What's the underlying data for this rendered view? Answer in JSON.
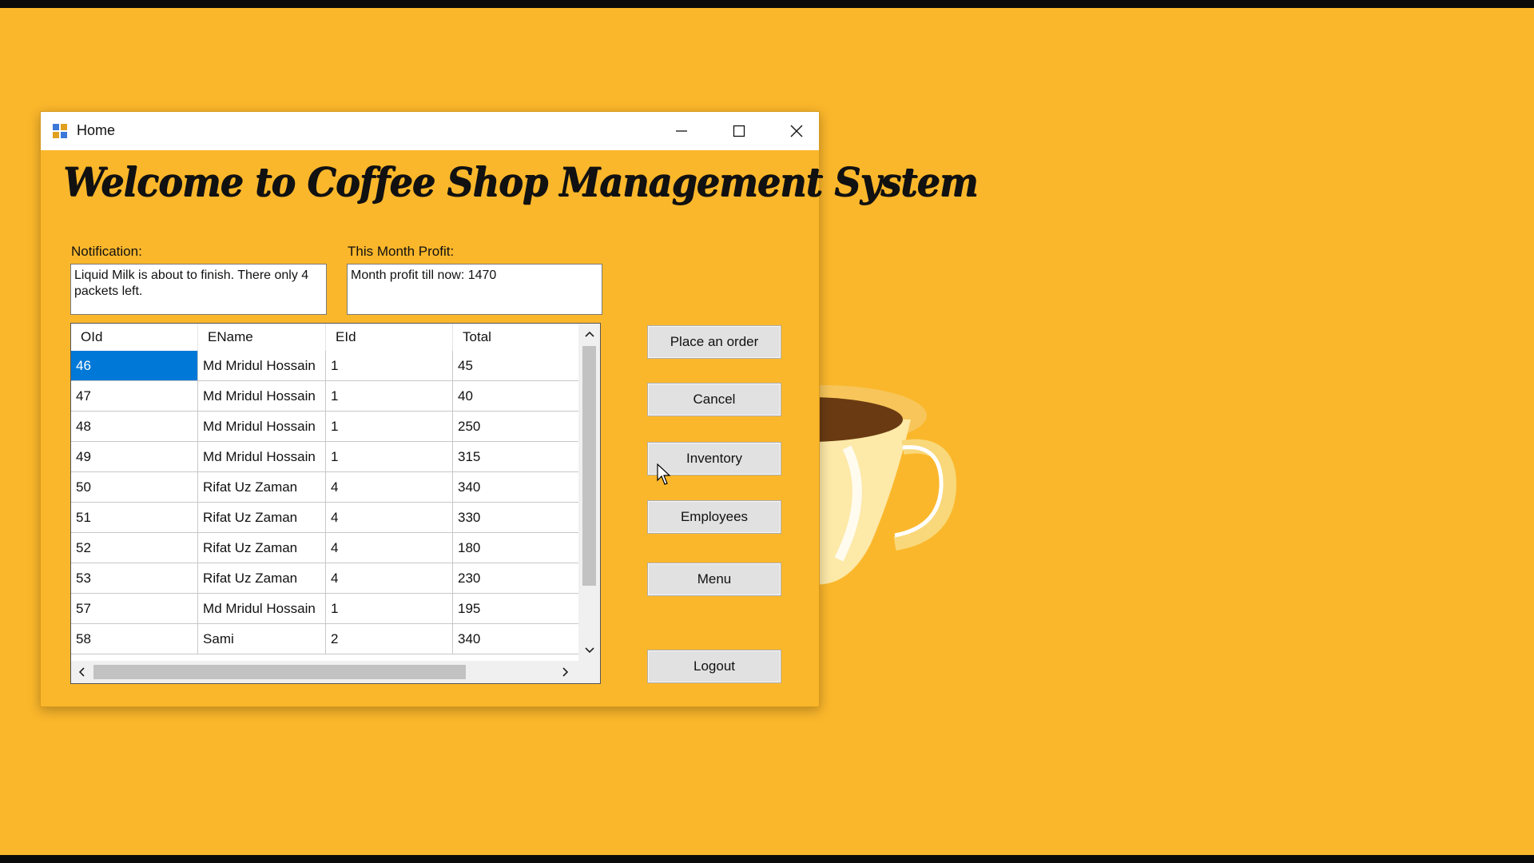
{
  "window": {
    "title": "Home"
  },
  "heading": "Welcome to Coffee Shop Management System",
  "notification": {
    "label": "Notification:",
    "text": "Liquid Milk is about to finish. There only 4 packets left."
  },
  "profit": {
    "label": "This Month Profit:",
    "text": "Month profit till now: 1470"
  },
  "grid": {
    "columns": [
      "OId",
      "EName",
      "EId",
      "Total"
    ],
    "rows": [
      [
        "46",
        "Md Mridul Hossain",
        "1",
        "45"
      ],
      [
        "47",
        "Md Mridul Hossain",
        "1",
        "40"
      ],
      [
        "48",
        "Md Mridul Hossain",
        "1",
        "250"
      ],
      [
        "49",
        "Md Mridul Hossain",
        "1",
        "315"
      ],
      [
        "50",
        "Rifat Uz Zaman",
        "4",
        "340"
      ],
      [
        "51",
        "Rifat Uz Zaman",
        "4",
        "330"
      ],
      [
        "52",
        "Rifat Uz Zaman",
        "4",
        "180"
      ],
      [
        "53",
        "Rifat Uz Zaman",
        "4",
        "230"
      ],
      [
        "57",
        "Md Mridul Hossain",
        "1",
        "195"
      ],
      [
        "58",
        "Sami",
        "2",
        "340"
      ]
    ],
    "selected_row": 0
  },
  "buttons": {
    "place_order": "Place an order",
    "cancel": "Cancel",
    "inventory": "Inventory",
    "employees": "Employees",
    "menu": "Menu",
    "logout": "Logout"
  },
  "colors": {
    "background": "#fbb72b",
    "selection": "#0078d7"
  }
}
